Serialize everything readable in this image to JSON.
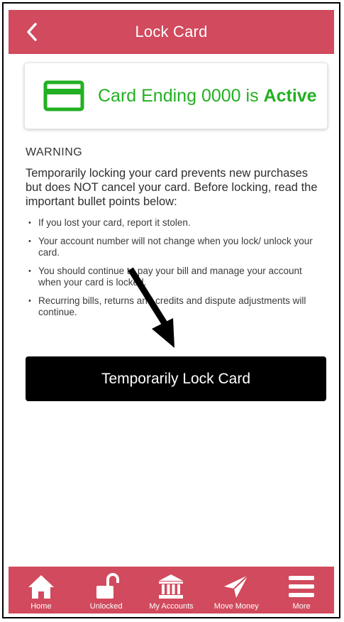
{
  "header": {
    "title": "Lock Card",
    "back_icon": "chevron-left-icon"
  },
  "status": {
    "prefix": "Card Ending",
    "last4": "0000",
    "middle": "is",
    "state": "Active",
    "icon": "credit-card-icon",
    "color": "#22b022"
  },
  "warning": {
    "title": "WARNING",
    "body": "Temporarily locking your card prevents new purchases but does NOT cancel your card. Before locking, read the important bullet points below:",
    "bullets": [
      "If you lost your card, report it stolen.",
      "Your account number will not change when you lock/ unlock your card.",
      "You should continue to pay your bill and manage your account when your card is locked.",
      "Recurring bills, returns and credits and dispute adjustments will continue."
    ]
  },
  "action": {
    "lock_label": "Temporarily Lock Card"
  },
  "nav": {
    "items": [
      {
        "label": "Home",
        "icon": "home-icon"
      },
      {
        "label": "Unlocked",
        "icon": "unlocked-padlock-icon"
      },
      {
        "label": "My Accounts",
        "icon": "bank-icon"
      },
      {
        "label": "Move Money",
        "icon": "paper-plane-icon"
      },
      {
        "label": "More",
        "icon": "hamburger-menu-icon"
      }
    ]
  },
  "colors": {
    "brand": "#d14a5d",
    "button": "#000000",
    "active": "#22b022"
  }
}
